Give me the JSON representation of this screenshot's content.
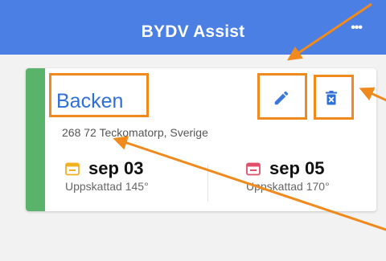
{
  "app": {
    "title": "BYDV Assist",
    "more_label": "•••",
    "header_color": "#4c7fe4"
  },
  "card": {
    "accent_color": "#59b36a",
    "title": "Backen",
    "address": "268 72 Teckomatorp, Sverige",
    "edit_icon": "pencil-icon",
    "delete_icon": "trash-icon",
    "dates": [
      {
        "date": "sep 03",
        "estimate": "Uppskattad 145°",
        "icon": "calendar-icon",
        "icon_color": "#f3b020"
      },
      {
        "date": "sep 05",
        "estimate": "Uppskattad 170°",
        "icon": "calendar-icon",
        "icon_color": "#e0506a"
      }
    ]
  },
  "annotations": {
    "color": "#f08a1c"
  }
}
